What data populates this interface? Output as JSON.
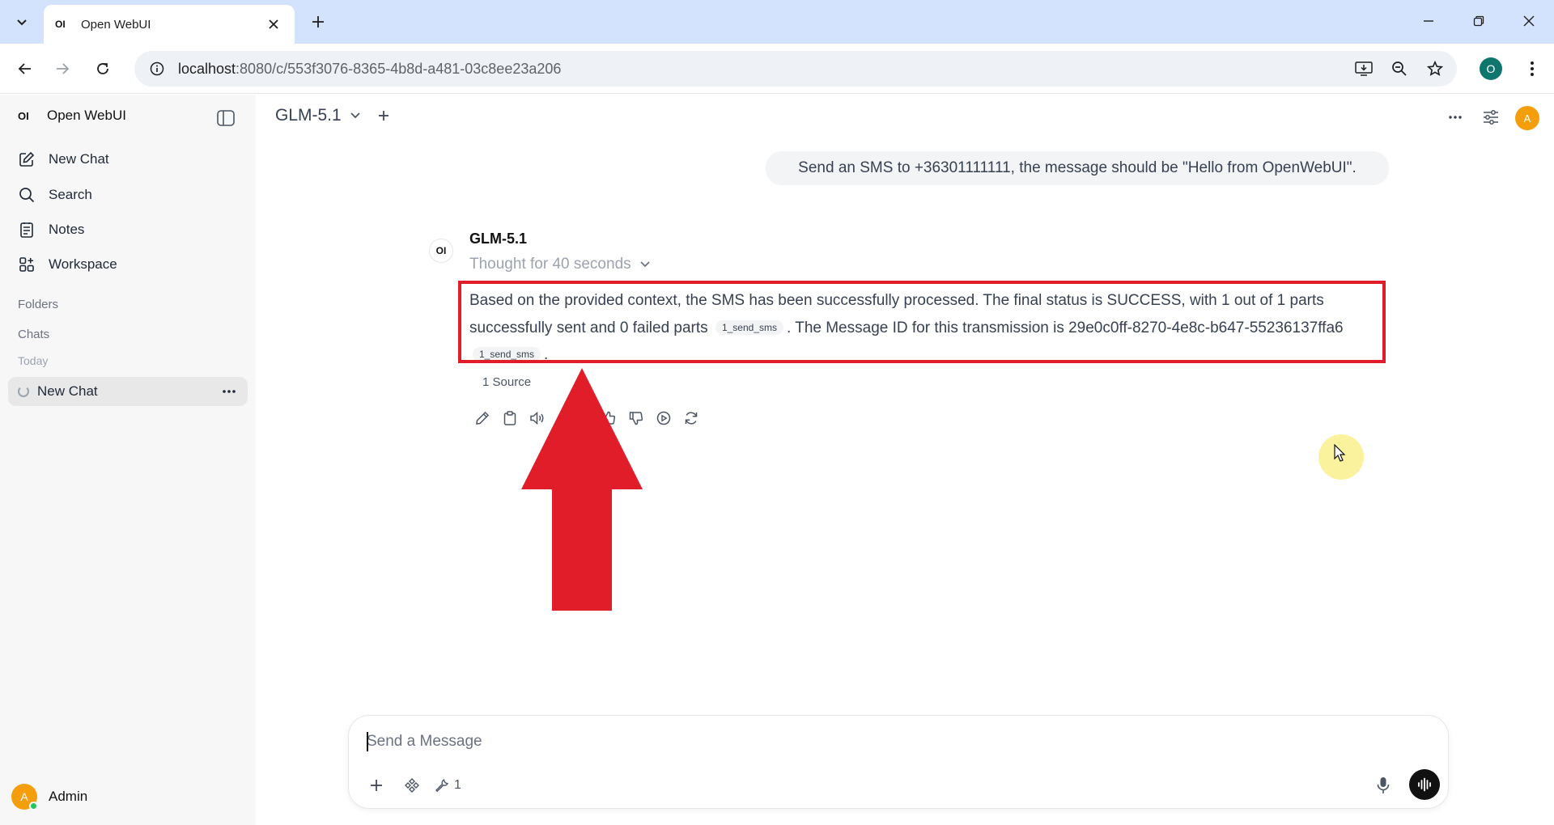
{
  "browser": {
    "tab_title": "Open WebUI",
    "tab_favicon": "OI",
    "url_host": "localhost",
    "url_path": ":8080/c/553f3076-8365-4b8d-a481-03c8ee23a206",
    "profile_initial": "O"
  },
  "sidebar": {
    "brand_logo": "OI",
    "brand_name": "Open WebUI",
    "items": [
      {
        "label": "New Chat",
        "icon": "pencil-square-icon"
      },
      {
        "label": "Search",
        "icon": "search-icon"
      },
      {
        "label": "Notes",
        "icon": "notes-icon"
      },
      {
        "label": "Workspace",
        "icon": "workspace-icon"
      }
    ],
    "folders_label": "Folders",
    "chats_label": "Chats",
    "today_label": "Today",
    "active_chat": "New Chat",
    "user": {
      "initial": "A",
      "name": "Admin"
    }
  },
  "header": {
    "model_name": "GLM-5.1",
    "avatar_initial": "A"
  },
  "conversation": {
    "user_message": "Send an SMS to +36301111111, the message should be \"Hello from OpenWebUI\".",
    "bot_logo": "OI",
    "bot_name": "GLM-5.1",
    "thought": "Thought for 40 seconds",
    "answer_part1": "Based on the provided context, the SMS has been successfully processed. The final status is SUCCESS, with 1 out of 1 parts successfully sent and 0 failed parts",
    "citation1": "1_send_sms",
    "answer_part2": ". The Message ID for this transmission is 29e0c0ff-8270-4e8c-b647-55236137ffa6",
    "citation2": "1_send_sms",
    "answer_part3": ".",
    "source_label": "1 Source"
  },
  "composer": {
    "placeholder": "Send a Message",
    "tools_count": "1"
  },
  "colors": {
    "annotation_red": "#e11d2a",
    "tab_strip": "#d3e3fd",
    "avatar_orange": "#f59e0b",
    "profile_teal": "#0f766e"
  }
}
